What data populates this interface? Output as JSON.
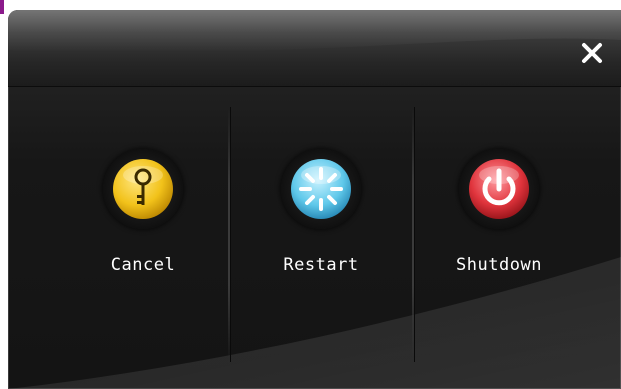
{
  "dialog": {
    "close_symbol": "✕",
    "close_icon": "close-icon"
  },
  "options": [
    {
      "label": "Cancel",
      "icon": "key-icon",
      "color": "#f2c21a"
    },
    {
      "label": "Restart",
      "icon": "restart-spinner-icon",
      "color": "#5fc8ea"
    },
    {
      "label": "Shutdown",
      "icon": "power-icon",
      "color": "#e0343c"
    }
  ],
  "colors": {
    "background": "#141414",
    "titlebar": "#3c3c3c",
    "text": "#ffffff"
  }
}
